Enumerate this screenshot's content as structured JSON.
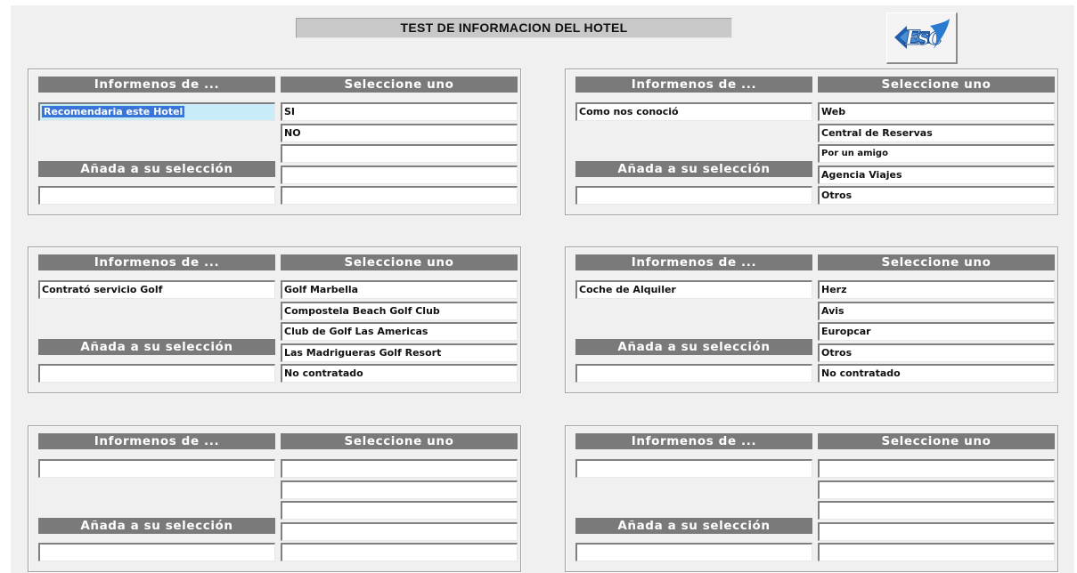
{
  "title": "TEST DE INFORMACION DEL HOTEL",
  "logo_icon": "esc-logo-icon",
  "labels": {
    "informenos": "Informenos de ...",
    "seleccione": "Seleccione uno",
    "anada": "Añada a su selección"
  },
  "panels": [
    {
      "question": "Recomendaria este Hotel",
      "question_selected": true,
      "options": [
        "SI",
        "NO",
        "",
        "",
        ""
      ],
      "add_value": ""
    },
    {
      "question": "Como nos conoció",
      "question_selected": false,
      "options": [
        "Web",
        "Central de Reservas",
        "Por un amigo",
        "Agencia Viajes",
        "Otros"
      ],
      "add_value": ""
    },
    {
      "question": "Contrató servicio Golf",
      "question_selected": false,
      "options": [
        "Golf Marbella",
        "Compostela Beach Golf Club",
        "Club de Golf Las Americas",
        "Las Madrigueras Golf Resort",
        "No contratado"
      ],
      "add_value": ""
    },
    {
      "question": "Coche de Alquiler",
      "question_selected": false,
      "options": [
        "Herz",
        "Avis",
        "Europcar",
        "Otros",
        "No contratado"
      ],
      "add_value": ""
    },
    {
      "question": "",
      "question_selected": false,
      "options": [
        "",
        "",
        "",
        "",
        ""
      ],
      "add_value": ""
    },
    {
      "question": "",
      "question_selected": false,
      "options": [
        "",
        "",
        "",
        "",
        ""
      ],
      "add_value": ""
    }
  ],
  "colors": {
    "header_bg": "#7a7a7a",
    "selection_bg": "#3875d7",
    "highlight_bg": "#c9ecfa"
  }
}
